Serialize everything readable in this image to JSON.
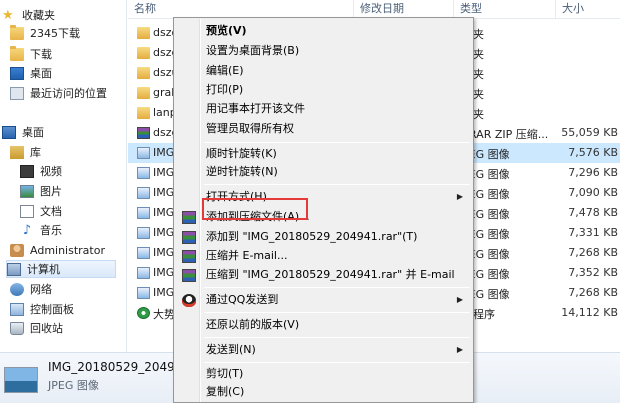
{
  "nav": {
    "items": [
      {
        "label": "收藏夹",
        "icon": "star-icon"
      },
      {
        "label": "2345下载",
        "icon": "folder-icon"
      },
      {
        "label": "下载",
        "icon": "folder-icon"
      },
      {
        "label": "桌面",
        "icon": "desktop-icon"
      },
      {
        "label": "最近访问的位置",
        "icon": "recent-places-icon"
      },
      {
        "label": "桌面",
        "icon": "monitor-icon"
      },
      {
        "label": "库",
        "icon": "library-icon"
      },
      {
        "label": "视频",
        "icon": "video-icon"
      },
      {
        "label": "图片",
        "icon": "picture-icon"
      },
      {
        "label": "文档",
        "icon": "document-icon"
      },
      {
        "label": "音乐",
        "icon": "music-icon"
      },
      {
        "label": "Administrator",
        "icon": "user-icon"
      },
      {
        "label": "计算机",
        "icon": "computer-icon"
      },
      {
        "label": "网络",
        "icon": "network-icon"
      },
      {
        "label": "控制面板",
        "icon": "control-panel-icon"
      },
      {
        "label": "回收站",
        "icon": "recycle-bin-icon"
      }
    ]
  },
  "list": {
    "headers": {
      "name": "名称",
      "date": "修改日期",
      "type": "类型",
      "size": "大小"
    },
    "rows": [
      {
        "name": "dszo",
        "type": "件夹",
        "size": "",
        "icon": "folder-icon"
      },
      {
        "name": "dszg",
        "type": "件夹",
        "size": "",
        "icon": "folder-icon"
      },
      {
        "name": "dszu",
        "type": "件夹",
        "size": "",
        "icon": "folder-icon"
      },
      {
        "name": "grab",
        "type": "件夹",
        "size": "",
        "icon": "folder-icon"
      },
      {
        "name": "lanp",
        "type": "件夹",
        "size": "",
        "icon": "folder-icon"
      },
      {
        "name": "dszg",
        "type": "nRAR ZIP 压缩...",
        "size": "55,059 KB",
        "icon": "rar-archive-icon"
      },
      {
        "name": "IMG",
        "type": "PEG 图像",
        "size": "7,576 KB",
        "icon": "image-file-icon"
      },
      {
        "name": "IMG",
        "type": "PEG 图像",
        "size": "7,296 KB",
        "icon": "image-file-icon"
      },
      {
        "name": "IMG",
        "type": "PEG 图像",
        "size": "7,090 KB",
        "icon": "image-file-icon"
      },
      {
        "name": "IMG",
        "type": "PEG 图像",
        "size": "7,478 KB",
        "icon": "image-file-icon"
      },
      {
        "name": "IMG",
        "type": "PEG 图像",
        "size": "7,331 KB",
        "icon": "image-file-icon"
      },
      {
        "name": "IMG",
        "type": "PEG 图像",
        "size": "7,268 KB",
        "icon": "image-file-icon"
      },
      {
        "name": "IMG",
        "type": "PEG 图像",
        "size": "7,352 KB",
        "icon": "image-file-icon"
      },
      {
        "name": "IMG",
        "type": "PEG 图像",
        "size": "7,268 KB",
        "icon": "image-file-icon"
      },
      {
        "name": "大势",
        "type": "用程序",
        "size": "14,112 KB",
        "icon": "application-icon"
      }
    ]
  },
  "details": {
    "filename": "IMG_20180529_204941",
    "filetype": "JPEG 图像"
  },
  "menu": {
    "items": [
      {
        "label": "预览(V)"
      },
      {
        "label": "设置为桌面背景(B)"
      },
      {
        "label": "编辑(E)"
      },
      {
        "label": "打印(P)"
      },
      {
        "label": "用记事本打开该文件"
      },
      {
        "label": "管理员取得所有权"
      },
      {
        "label": "顺时针旋转(K)"
      },
      {
        "label": "逆时针旋转(N)"
      },
      {
        "label": "打开方式(H)"
      },
      {
        "label": "添加到压缩文件(A)..."
      },
      {
        "label": "添加到 \"IMG_20180529_204941.rar\"(T)"
      },
      {
        "label": "压缩并 E-mail..."
      },
      {
        "label": "压缩到 \"IMG_20180529_204941.rar\" 并 E-mail"
      },
      {
        "label": "通过QQ发送到"
      },
      {
        "label": "还原以前的版本(V)"
      },
      {
        "label": "发送到(N)"
      },
      {
        "label": "剪切(T)"
      },
      {
        "label": "复制(C)"
      }
    ]
  },
  "colors": {
    "selection": "#cce8ff",
    "highlight_box": "#e53a3a",
    "menu_bg": "#f0f0f0"
  }
}
